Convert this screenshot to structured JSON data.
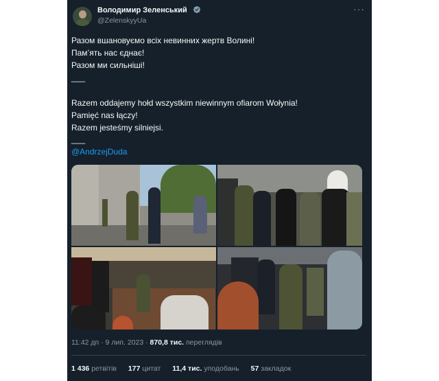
{
  "author": {
    "name": "Володимир Зеленський",
    "handle": "@ZelenskyyUa"
  },
  "colors": {
    "background": "#15202b",
    "text": "#f7f9f9",
    "muted": "#8b98a5",
    "link": "#1d9bf0",
    "verified": "#829aab"
  },
  "icons": {
    "verified": "verified-badge-icon",
    "more": "more-options-icon"
  },
  "tweet": {
    "lines": [
      "Разом вшановуємо всіх невинних жертв Волині!",
      "Пам’ять нас єднає!",
      "Разом ми сильніші!",
      "___",
      "Razem oddajemy hołd wszystkim niewinnym ofiarom Wołynia!",
      "Pamięć nas łączy!",
      "Razem jesteśmy silniejsi.",
      "___"
    ],
    "mention": "@AndrzejDuda"
  },
  "meta": {
    "time": "11:42 дп · 9 лип. 2023 ·",
    "views": "870,8 тис.",
    "views_label": "переглядів"
  },
  "stats": {
    "retweets": "1 436",
    "retweets_label": "ретвітів",
    "quotes": "177",
    "quotes_label": "цитат",
    "likes": "11,4 тис.",
    "likes_label": "уподобань",
    "bookmarks": "57",
    "bookmarks_label": "закладок"
  }
}
